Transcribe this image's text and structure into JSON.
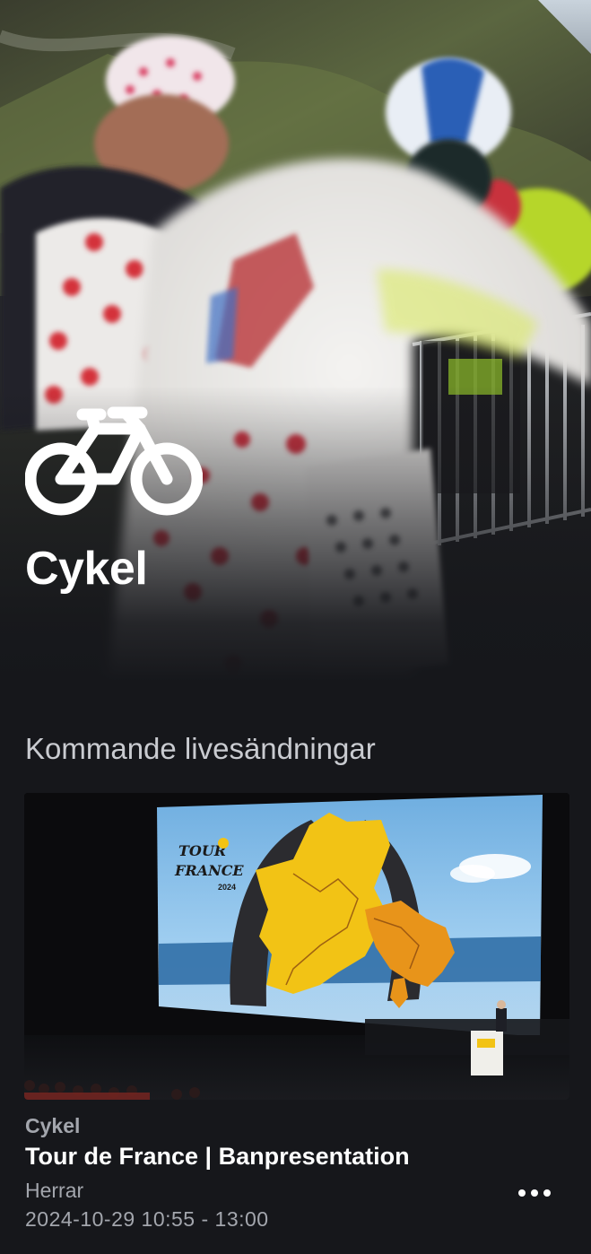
{
  "hero": {
    "title": "Cykel",
    "icon": "bicycle-icon"
  },
  "section": {
    "title": "Kommande livesändningar"
  },
  "event": {
    "sport": "Cykel",
    "title": "Tour de France | Banpresentation",
    "category": "Herrar",
    "time": "2024-10-29 10:55 - 13:00",
    "menu_icon": "more-horizontal-icon",
    "thumbnail": {
      "logo_line1": "TOUR",
      "logo_line2": "FRANCE",
      "logo_year": "2024"
    }
  },
  "colors": {
    "background": "#16171b",
    "secondary_text": "#a3a6ad",
    "section_text": "#c9cbd0",
    "map_yellow": "#f2c315",
    "map_orange": "#e8941a"
  }
}
